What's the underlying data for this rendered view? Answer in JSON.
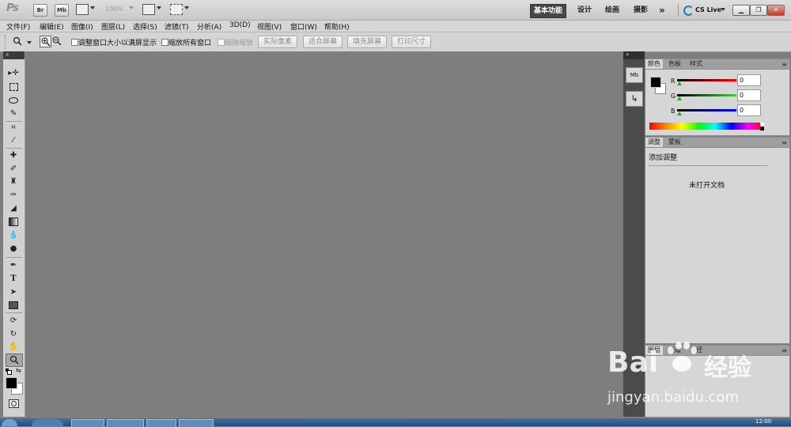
{
  "app": {
    "logo": "Ps",
    "zoom": "100%"
  },
  "titlebar": {
    "bridge": "Br",
    "minibridge": "Mb",
    "workspaces": [
      "基本功能",
      "设计",
      "绘画",
      "摄影"
    ],
    "more": "»",
    "cslive": "CS Live",
    "win_min": "▁",
    "win_max": "❐",
    "win_close": "✕"
  },
  "menubar": {
    "items": [
      "文件(F)",
      "编辑(E)",
      "图像(I)",
      "图层(L)",
      "选择(S)",
      "滤镜(T)",
      "分析(A)",
      "3D(D)",
      "视图(V)",
      "窗口(W)",
      "帮助(H)"
    ]
  },
  "options": {
    "resize_windows": "调整窗口大小以满屏显示",
    "zoom_all": "缩放所有窗口",
    "scrubby_zoom": "细微缩放",
    "actual_pixels": "实际像素",
    "fit_screen": "适合屏幕",
    "fill_screen": "填充屏幕",
    "print_size": "打印尺寸"
  },
  "tools": [
    "move-icon",
    "marquee-icon",
    "lasso-icon",
    "quick-select-icon",
    "crop-icon",
    "eyedropper-icon",
    "healing-brush-icon",
    "brush-icon",
    "clone-stamp-icon",
    "history-brush-icon",
    "eraser-icon",
    "gradient-icon",
    "blur-icon",
    "dodge-icon",
    "pen-icon",
    "type-icon",
    "path-select-icon",
    "shape-icon",
    "3d-rotate-icon",
    "3d-orbit-icon",
    "hand-icon",
    "zoom-icon"
  ],
  "dock": {
    "item1": "Mb",
    "item2": "↳"
  },
  "color_panel": {
    "tabs": [
      "颜色",
      "色板",
      "样式"
    ],
    "r_label": "R",
    "g_label": "G",
    "b_label": "B",
    "r": "0",
    "g": "0",
    "b": "0"
  },
  "adjustments_panel": {
    "tabs": [
      "调整",
      "蒙板"
    ],
    "title": "添加调整",
    "message": "未打开文档"
  },
  "layers_panel": {
    "tabs": [
      "图层",
      "通道",
      "路径"
    ]
  },
  "watermark": {
    "brand": "Bai",
    "brand2": "经验",
    "url": "jingyan.baidu.com"
  },
  "taskbar": {
    "clock": "12:00"
  }
}
